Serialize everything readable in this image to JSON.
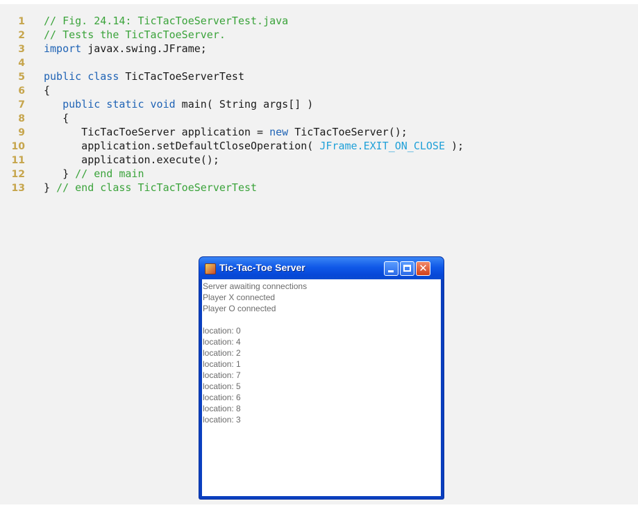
{
  "code": {
    "lines": [
      {
        "num": "1",
        "parts": [
          {
            "text": "// Fig. 24.14: TicTacToeServerTest.java",
            "style": "comment"
          }
        ]
      },
      {
        "num": "2",
        "parts": [
          {
            "text": "// Tests the TicTacToeServer.",
            "style": "comment"
          }
        ]
      },
      {
        "num": "3",
        "parts": [
          {
            "text": "import",
            "style": "kw"
          },
          {
            "text": " javax.swing.JFrame;",
            "style": "plain"
          }
        ]
      },
      {
        "num": "4",
        "parts": []
      },
      {
        "num": "5",
        "parts": [
          {
            "text": "public class",
            "style": "kw"
          },
          {
            "text": " TicTacToeServerTest",
            "style": "plain"
          }
        ]
      },
      {
        "num": "6",
        "parts": [
          {
            "text": "{",
            "style": "plain"
          }
        ]
      },
      {
        "num": "7",
        "parts": [
          {
            "text": "   ",
            "style": "plain"
          },
          {
            "text": "public static void",
            "style": "kw"
          },
          {
            "text": " main( String args[] )",
            "style": "plain"
          }
        ]
      },
      {
        "num": "8",
        "parts": [
          {
            "text": "   {",
            "style": "plain"
          }
        ]
      },
      {
        "num": "9",
        "parts": [
          {
            "text": "      TicTacToeServer application = ",
            "style": "plain"
          },
          {
            "text": "new",
            "style": "kw"
          },
          {
            "text": " TicTacToeServer();",
            "style": "plain"
          }
        ]
      },
      {
        "num": "10",
        "parts": [
          {
            "text": "      application.setDefaultCloseOperation( ",
            "style": "plain"
          },
          {
            "text": "JFrame.EXIT_ON_CLOSE",
            "style": "const"
          },
          {
            "text": " );",
            "style": "plain"
          }
        ]
      },
      {
        "num": "11",
        "parts": [
          {
            "text": "      application.execute();",
            "style": "plain"
          }
        ]
      },
      {
        "num": "12",
        "parts": [
          {
            "text": "   } ",
            "style": "plain"
          },
          {
            "text": "// end main",
            "style": "comment"
          }
        ]
      },
      {
        "num": "13",
        "parts": [
          {
            "text": "} ",
            "style": "plain"
          },
          {
            "text": "// end class TicTacToeServerTest",
            "style": "comment"
          }
        ]
      }
    ]
  },
  "window": {
    "title": "Tic-Tac-Toe Server",
    "log_lines": [
      "Server awaiting connections",
      "Player X connected",
      "Player O connected",
      "",
      "location: 0",
      "location: 4",
      "location: 2",
      "location: 1",
      "location: 7",
      "location: 5",
      "location: 6",
      "location: 8",
      "location: 3"
    ]
  },
  "icons": {
    "app_icon": "java-app-icon",
    "minimize": "minimize-icon",
    "maximize": "maximize-icon",
    "close": "close-icon"
  },
  "colors": {
    "line_numbers": "#c6a54c",
    "comment": "#3aa33a",
    "keyword": "#1f63b5",
    "constant": "#1fa0d8",
    "titlebar": "#0648d8",
    "close_button": "#d2401a"
  }
}
